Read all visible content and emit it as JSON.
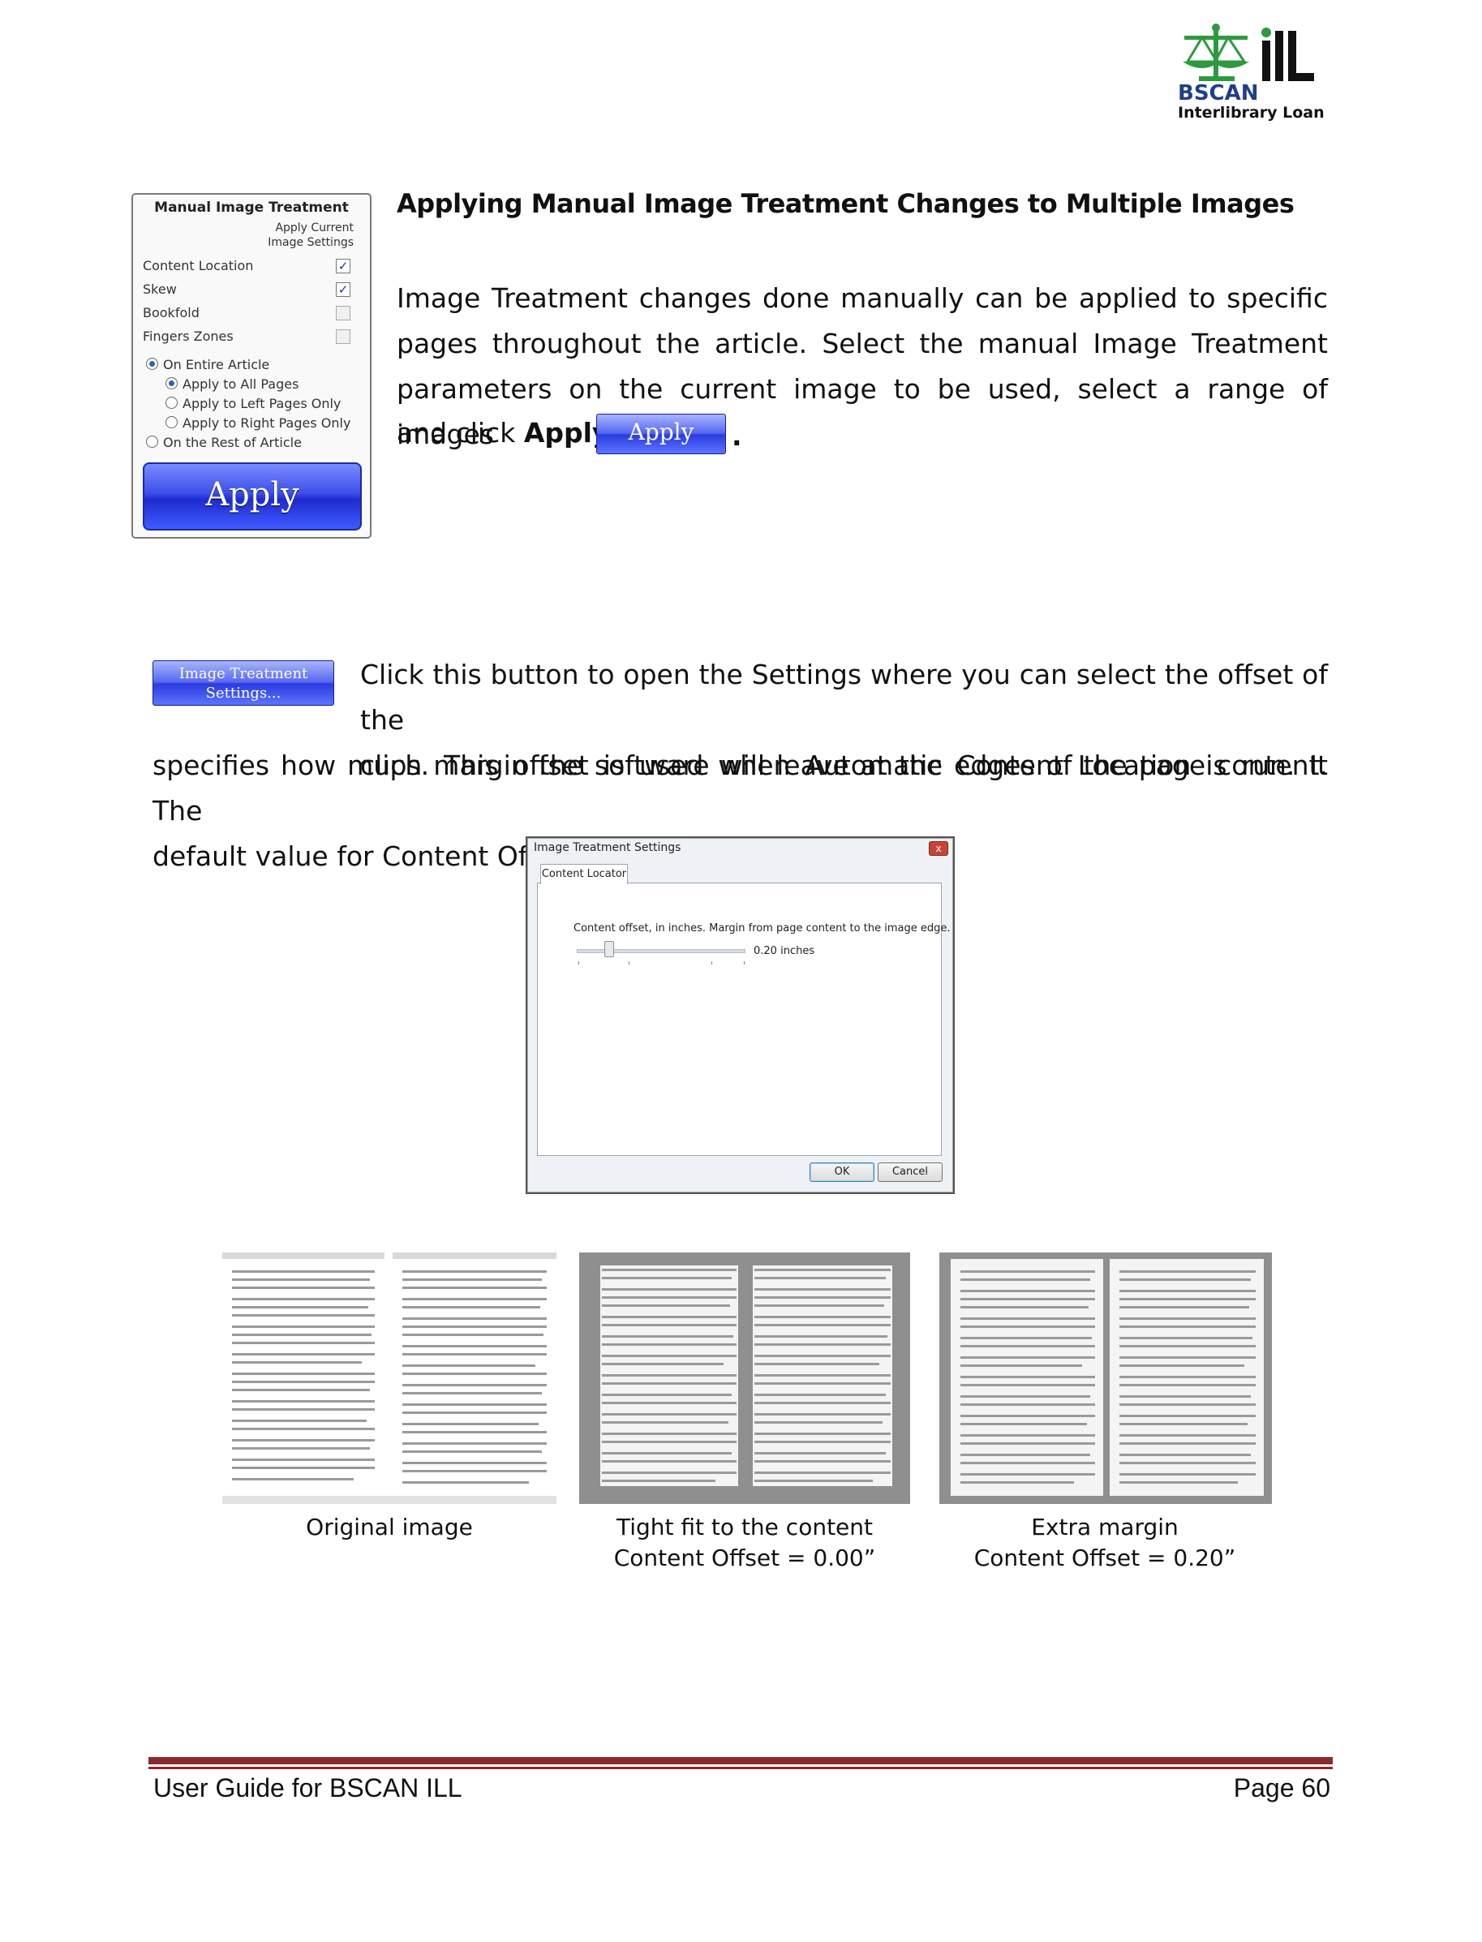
{
  "header": {
    "logo_brand": "BSCAN",
    "logo_ill": "ILL",
    "logo_subtitle": "Interlibrary Loan",
    "brand_color": "#1f3f8a",
    "scale_color": "#2e9a3e"
  },
  "panel": {
    "title": "Manual Image Treatment",
    "column_header_line1": "Apply Current",
    "column_header_line2": "Image Settings",
    "rows": [
      {
        "label": "Content Location",
        "checked": "✓"
      },
      {
        "label": "Skew",
        "checked": "✓"
      },
      {
        "label": "Bookfold",
        "checked": ""
      },
      {
        "label": "Fingers Zones",
        "checked": ""
      }
    ],
    "radios": [
      {
        "label": "On Entire Article"
      },
      {
        "label": "Apply to All Pages"
      },
      {
        "label": "Apply to Left Pages Only"
      },
      {
        "label": "Apply to Right Pages Only"
      },
      {
        "label": "On the Rest of Article"
      }
    ],
    "apply_label": "Apply"
  },
  "section1": {
    "heading": "Applying Manual Image Treatment Changes to Multiple Images",
    "lines": [
      "Image Treatment changes done manually can be applied to specific",
      "pages throughout the article.  Select the manual Image Treatment",
      "parameters on the current image to be used, select a range of images"
    ],
    "last_prefix": "and click ",
    "last_bold": "Apply",
    "inline_button": "Apply",
    "period": "."
  },
  "section2": {
    "button_line1": "Image Treatment",
    "button_line2": "Settings...",
    "lines_indented": [
      "Click this button to open the Settings where you can select the offset of the",
      "clips.  This offset is used when Automatic Content Location is run.  It"
    ],
    "lines_full": [
      "specifies how much margin the software will leave at the edges of the page content.  The",
      "default value for Content Offset is 0.20”."
    ]
  },
  "dialog": {
    "title": "Image Treatment Settings",
    "close": "x",
    "tab": "Content Locator",
    "label": "Content offset, in inches. Margin from page content to the image edge.",
    "value": "0.20 inches",
    "ok": "OK",
    "cancel": "Cancel"
  },
  "samples": [
    {
      "line1": "Original image",
      "line2": ""
    },
    {
      "line1": "Tight fit to the content",
      "line2": "Content Offset = 0.00”"
    },
    {
      "line1": "Extra margin",
      "line2": "Content Offset = 0.20”"
    }
  ],
  "footer": {
    "left": "User Guide for BSCAN ILL",
    "right": "Page 60",
    "rule_color": "#8c2a2a"
  }
}
